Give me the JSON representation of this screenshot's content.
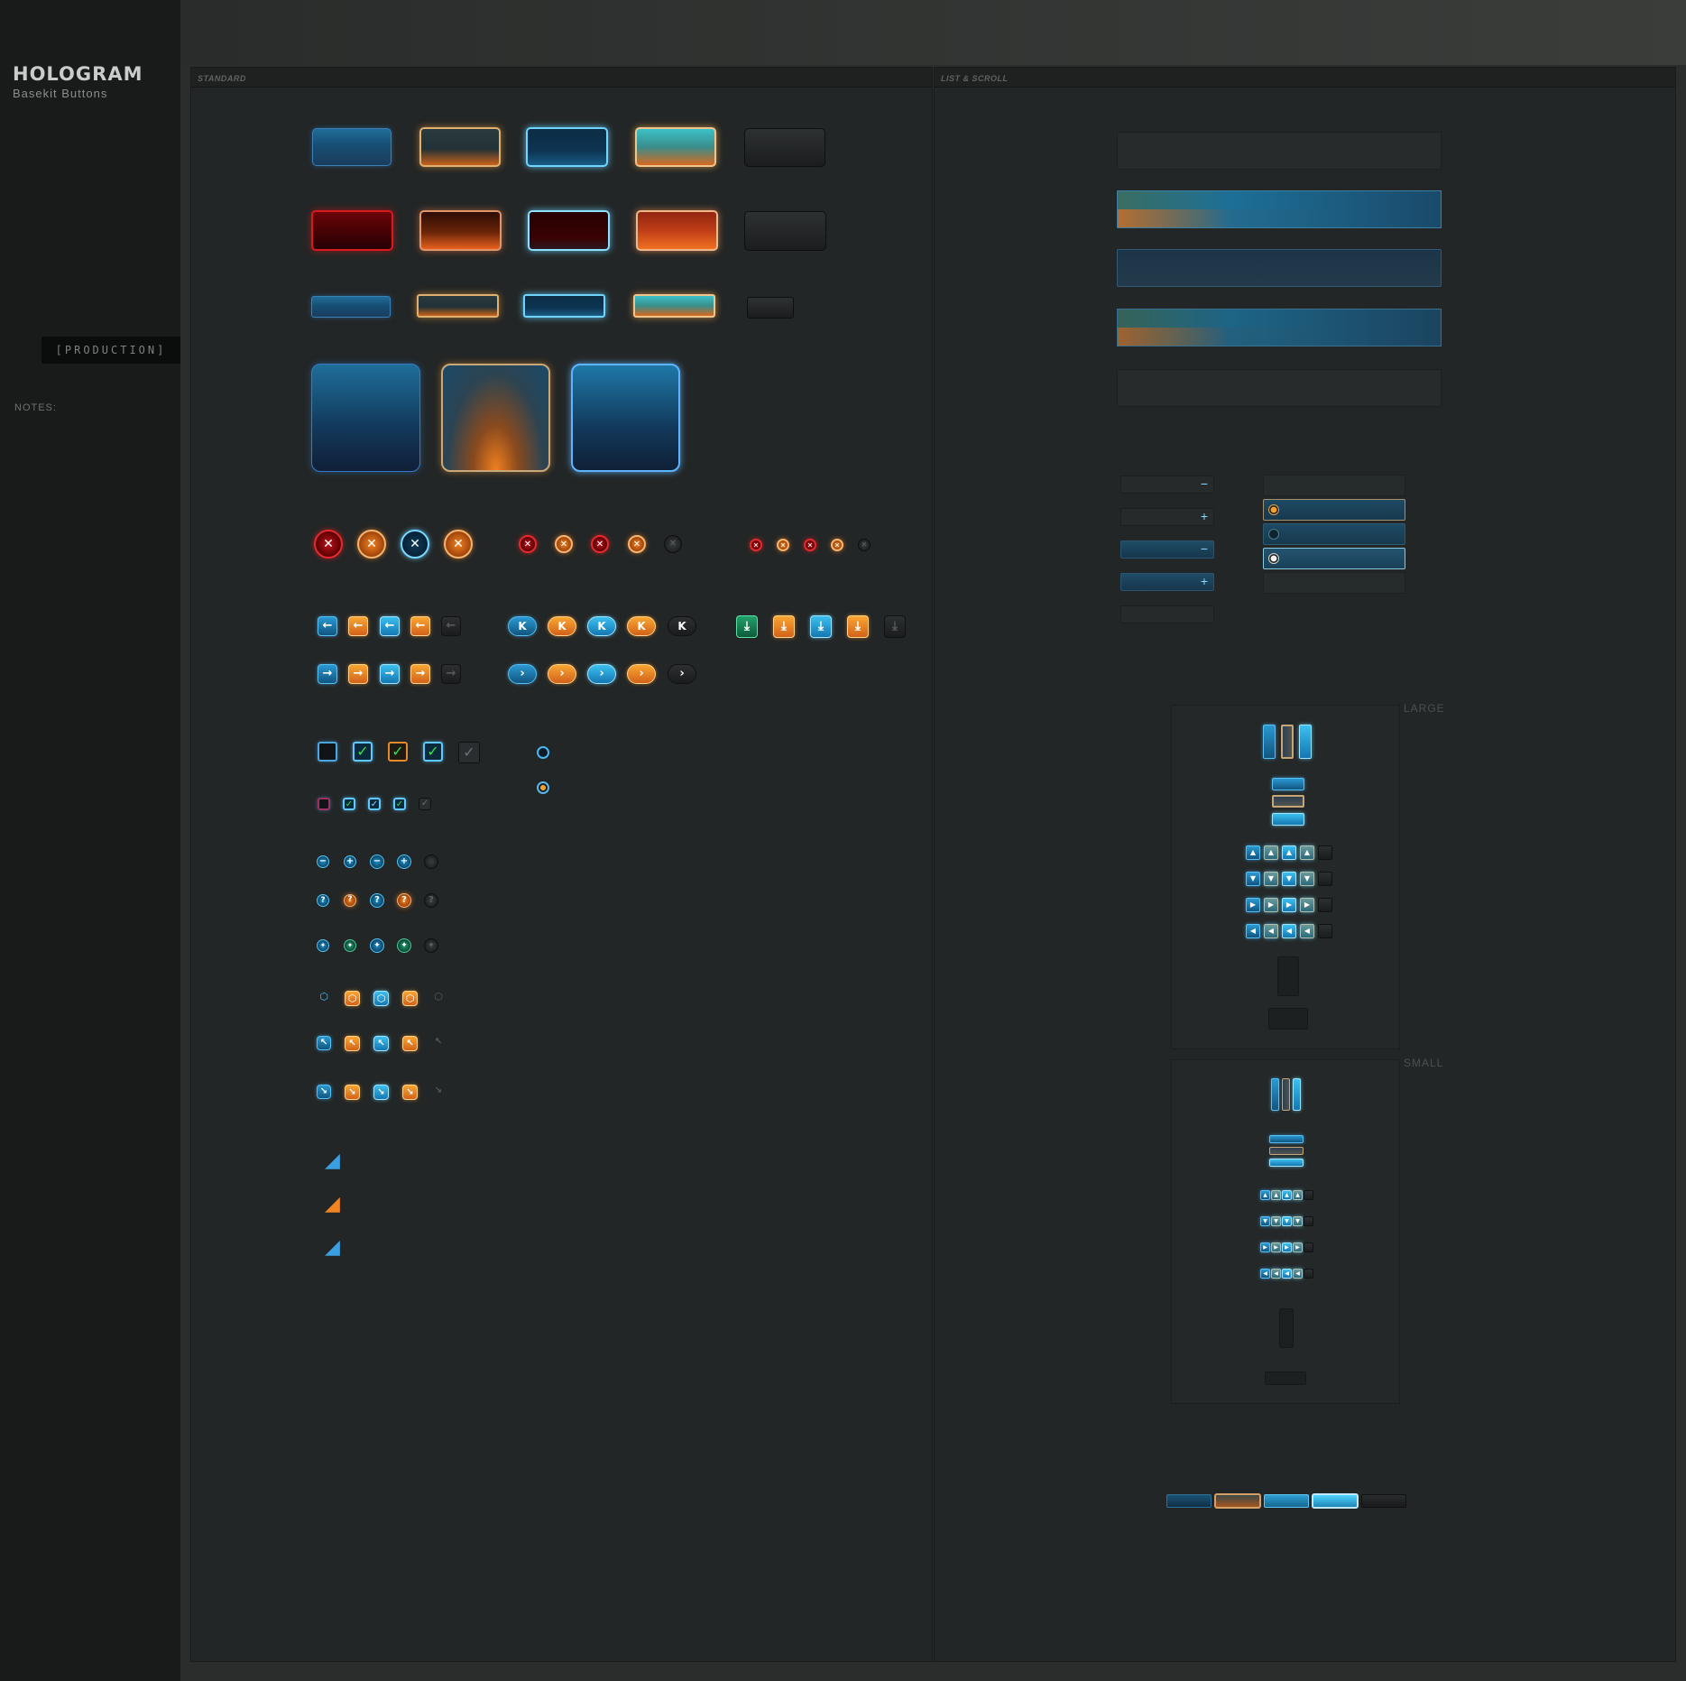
{
  "app": {
    "title": "HOLOGRAM",
    "subtitle": "Basekit Buttons",
    "status": "[PRODUCTION]",
    "notes_label": "NOTES:"
  },
  "panels": {
    "standard": {
      "label": "STANDARD"
    },
    "list": {
      "label": "LIST & SCROLL"
    }
  },
  "icons": {
    "close": "✕",
    "arrow_left": "←",
    "arrow_right": "→",
    "skip_back": "K",
    "skip_forward": "›",
    "download": "⤓",
    "check": "✓",
    "minus": "−",
    "plus": "+",
    "question": "?",
    "pin": "✦",
    "hex": "⬡",
    "arrow_upleft": "↖",
    "arrow_downright": "↘",
    "resize": "◢",
    "up": "▲",
    "down": "▼",
    "right": "▶",
    "left": "◀"
  },
  "scroll_labels": {
    "large": "LARGE",
    "small": "SMALL"
  },
  "colors": {
    "accent_blue": "#1f6d98",
    "accent_orange": "#f08420",
    "accent_red": "#d81a1f",
    "glow_cyan": "#6fd4ff",
    "background": "#232626",
    "sidebar": "#191a1a"
  }
}
